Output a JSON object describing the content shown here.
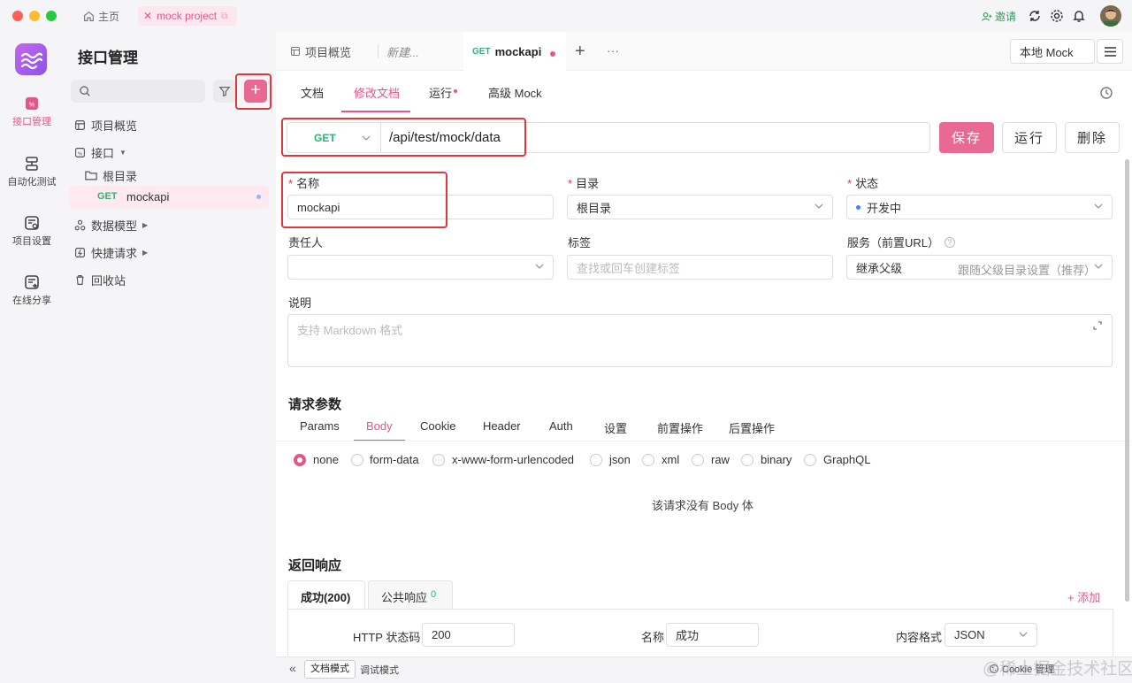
{
  "titlebar": {
    "home_label": "主页",
    "project_tab": "mock project",
    "invite_label": "邀请"
  },
  "rail": {
    "items": [
      {
        "label": "接口管理",
        "icon": "api-icon",
        "active": true
      },
      {
        "label": "自动化测试",
        "icon": "automation-icon",
        "active": false
      },
      {
        "label": "项目设置",
        "icon": "project-settings-icon",
        "active": false
      },
      {
        "label": "在线分享",
        "icon": "share-icon",
        "active": false
      }
    ]
  },
  "sidebar": {
    "title": "接口管理",
    "overview": "项目概览",
    "apis": "接口",
    "root": "根目录",
    "api_method": "GET",
    "api_name": "mockapi",
    "schemas": "数据模型",
    "quick": "快捷请求",
    "recycle": "回收站"
  },
  "tabs": {
    "overview": "项目概览",
    "new": "新建...",
    "active_method": "GET",
    "active_name": "mockapi",
    "env": "本地 Mock"
  },
  "subtabs": {
    "doc": "文档",
    "edit": "修改文档",
    "run": "运行",
    "mock": "高级 Mock"
  },
  "request": {
    "method": "GET",
    "url": "/api/test/mock/data",
    "save": "保存",
    "run": "运行",
    "delete": "删除"
  },
  "form": {
    "name_label": "名称",
    "name_value": "mockapi",
    "dir_label": "目录",
    "dir_value": "根目录",
    "status_label": "状态",
    "status_value": "开发中",
    "owner_label": "责任人",
    "tags_label": "标签",
    "tags_placeholder": "查找或回车创建标签",
    "service_label": "服务（前置URL）",
    "service_value": "继承父级",
    "service_hint": "跟随父级目录设置（推荐）",
    "desc_label": "说明",
    "desc_placeholder": "支持 Markdown 格式"
  },
  "params": {
    "title": "请求参数",
    "tabs": [
      "Params",
      "Body",
      "Cookie",
      "Header",
      "Auth",
      "设置",
      "前置操作",
      "后置操作"
    ],
    "body_types": [
      "none",
      "form-data",
      "x-www-form-urlencoded",
      "json",
      "xml",
      "raw",
      "binary",
      "GraphQL"
    ],
    "empty": "该请求没有 Body 体"
  },
  "response": {
    "title": "返回响应",
    "tab_success": "成功(200)",
    "tab_public": "公共响应",
    "tab_public_count": "0",
    "add": "+ 添加",
    "http_label": "HTTP 状态码",
    "http_value": "200",
    "name_label": "名称",
    "name_value": "成功",
    "format_label": "内容格式",
    "format_value": "JSON"
  },
  "bottombar": {
    "doc_mode": "文档模式",
    "debug_mode": "调试模式",
    "cookie": "Cookie 管理"
  },
  "watermark": "@稀土掘金技术社区",
  "colors": {
    "accent": "#e0588a",
    "get": "#2cb478",
    "highlight": "#e0373a"
  }
}
